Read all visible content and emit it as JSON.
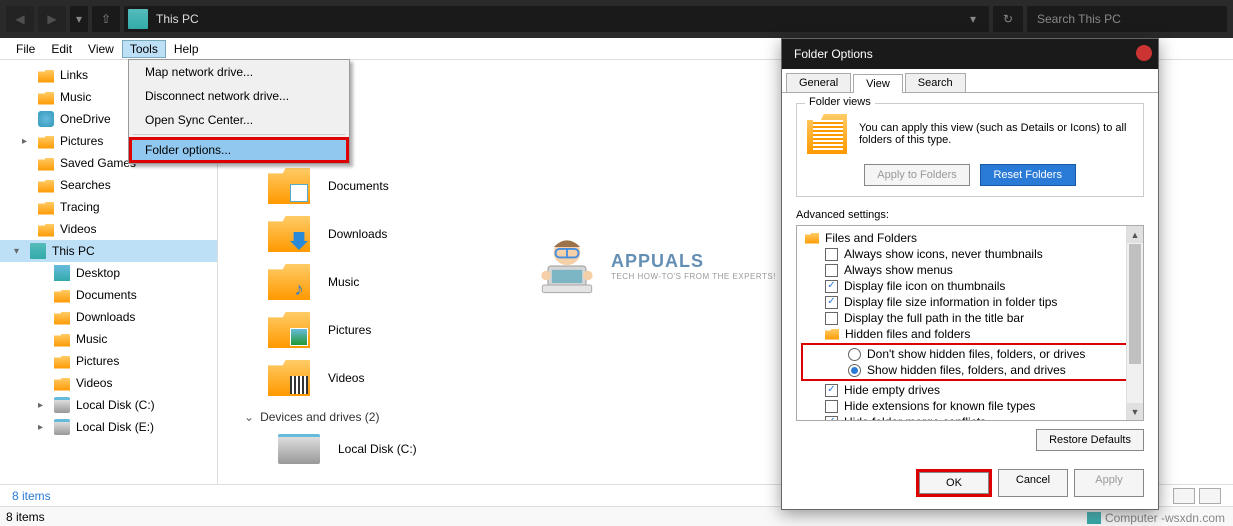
{
  "nav": {
    "breadcrumb": "This PC",
    "search_placeholder": "Search This PC"
  },
  "menubar": {
    "file": "File",
    "edit": "Edit",
    "view": "View",
    "tools": "Tools",
    "help": "Help"
  },
  "tools_menu": {
    "map": "Map network drive...",
    "disconnect": "Disconnect network drive...",
    "sync": "Open Sync Center...",
    "folder_options": "Folder options..."
  },
  "sidebar": {
    "items": [
      {
        "label": "Links"
      },
      {
        "label": "Music"
      },
      {
        "label": "OneDrive"
      },
      {
        "label": "Pictures"
      },
      {
        "label": "Saved Games"
      },
      {
        "label": "Searches"
      },
      {
        "label": "Tracing"
      },
      {
        "label": "Videos"
      }
    ],
    "thispc": "This PC",
    "pc_children": [
      {
        "label": "Desktop"
      },
      {
        "label": "Documents"
      },
      {
        "label": "Downloads"
      },
      {
        "label": "Music"
      },
      {
        "label": "Pictures"
      },
      {
        "label": "Videos"
      },
      {
        "label": "Local Disk (C:)"
      },
      {
        "label": "Local Disk (E:)"
      }
    ]
  },
  "content": {
    "folders": [
      {
        "label": "Documents"
      },
      {
        "label": "Downloads"
      },
      {
        "label": "Music"
      },
      {
        "label": "Pictures"
      },
      {
        "label": "Videos"
      }
    ],
    "section": "Devices and drives (2)",
    "drive": "Local Disk (C:)"
  },
  "status": {
    "items": "8 items",
    "items2": "8 items"
  },
  "dialog": {
    "title": "Folder Options",
    "tabs": {
      "general": "General",
      "view": "View",
      "search": "Search"
    },
    "folder_views": {
      "legend": "Folder views",
      "text": "You can apply this view (such as Details or Icons) to all folders of this type.",
      "apply": "Apply to Folders",
      "reset": "Reset Folders"
    },
    "adv_label": "Advanced settings:",
    "adv": {
      "root": "Files and Folders",
      "a1": "Always show icons, never thumbnails",
      "a2": "Always show menus",
      "a3": "Display file icon on thumbnails",
      "a4": "Display file size information in folder tips",
      "a5": "Display the full path in the title bar",
      "hidden": "Hidden files and folders",
      "r1": "Don't show hidden files, folders, or drives",
      "r2": "Show hidden files, folders, and drives",
      "a6": "Hide empty drives",
      "a7": "Hide extensions for known file types",
      "a8": "Hide folder merge conflicts"
    },
    "restore": "Restore Defaults",
    "ok": "OK",
    "cancel": "Cancel",
    "apply": "Apply"
  },
  "watermark": {
    "brand": "APPUALS",
    "tagline": "TECH HOW-TO'S FROM THE EXPERTS!"
  },
  "corner": "Computer -wsxdn.com"
}
